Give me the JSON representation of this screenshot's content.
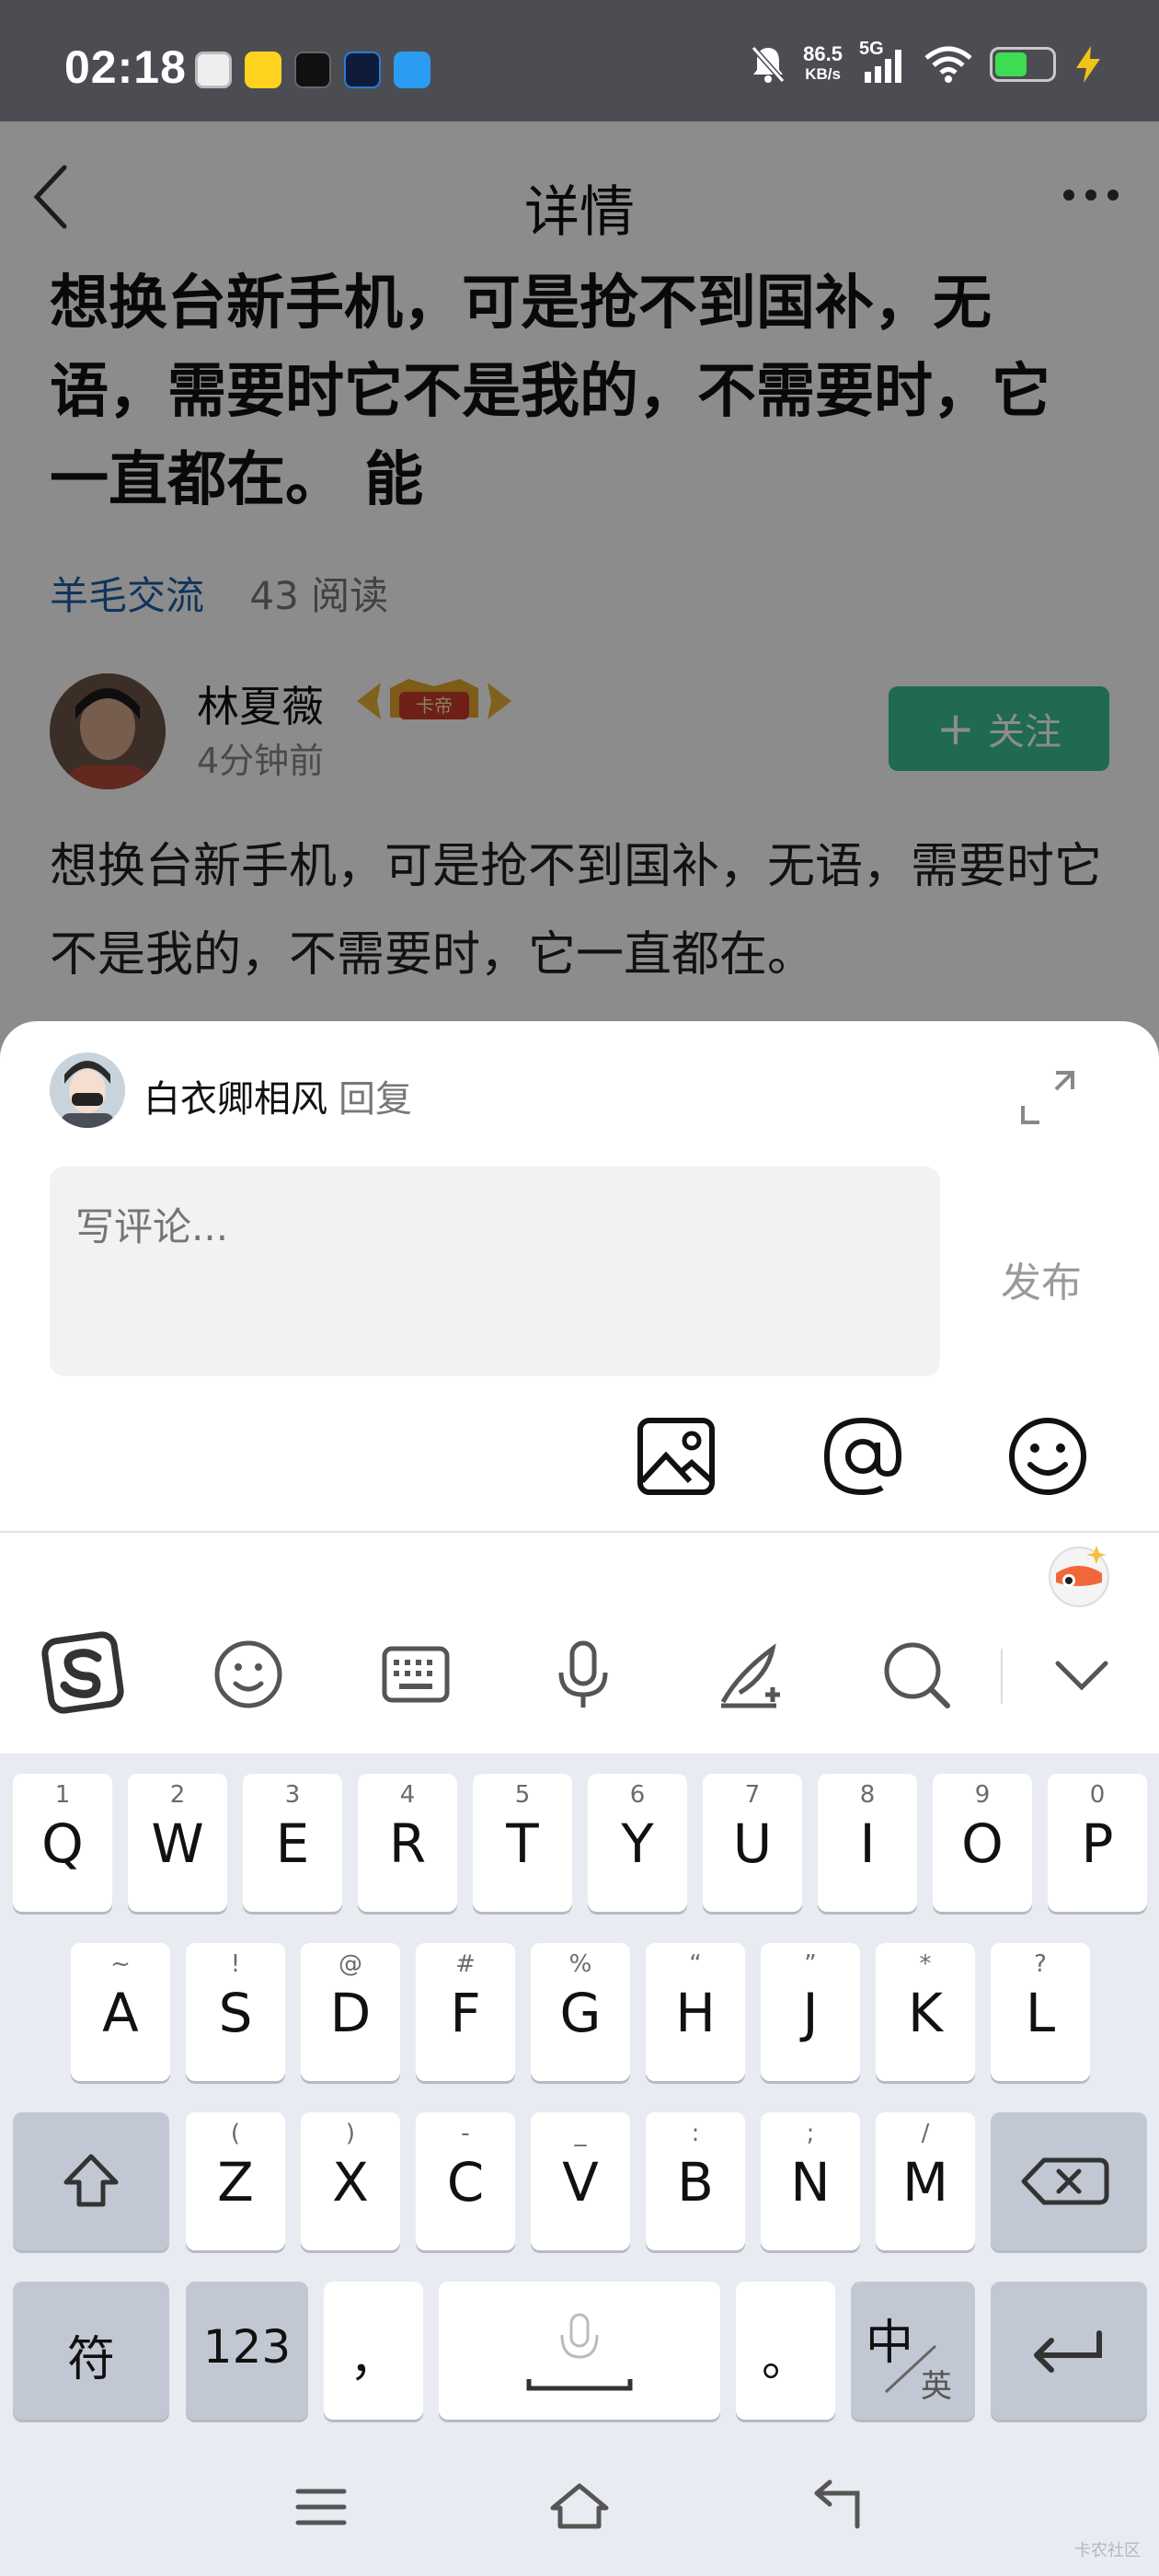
{
  "status_bar": {
    "time": "02:18",
    "net_speed_value": "86.5",
    "net_speed_unit": "KB/s",
    "network": "5G",
    "icons": [
      "mute-icon",
      "signal-icon",
      "wifi-icon",
      "battery-icon",
      "charging-icon"
    ]
  },
  "nav": {
    "title": "详情",
    "back_icon": "chevron-left-icon",
    "more_icon": "more-dots-icon"
  },
  "post": {
    "title": "想换台新手机，可是抢不到国补，无语，需要时它不是我的，不需要时，它一直都在。 能",
    "category": "羊毛交流",
    "read_count": "43 阅读",
    "author": "林夏薇",
    "author_badge": "卡帝",
    "time_ago": "4分钟前",
    "follow_label": "关注",
    "body": "想换台新手机，可是抢不到国补，无语，需要时它不是我的，不需要时，它一直都在。"
  },
  "reply": {
    "target_user": "白衣卿相风",
    "reply_label": "回复",
    "placeholder": "写评论...",
    "publish_label": "发布",
    "tools": [
      "image-icon",
      "mention-icon",
      "emoji-icon"
    ]
  },
  "keyboard": {
    "row1": [
      {
        "main": "Q",
        "sub": "1"
      },
      {
        "main": "W",
        "sub": "2"
      },
      {
        "main": "E",
        "sub": "3"
      },
      {
        "main": "R",
        "sub": "4"
      },
      {
        "main": "T",
        "sub": "5"
      },
      {
        "main": "Y",
        "sub": "6"
      },
      {
        "main": "U",
        "sub": "7"
      },
      {
        "main": "I",
        "sub": "8"
      },
      {
        "main": "O",
        "sub": "9"
      },
      {
        "main": "P",
        "sub": "0"
      }
    ],
    "row2": [
      {
        "main": "A",
        "sub": "~"
      },
      {
        "main": "S",
        "sub": "!"
      },
      {
        "main": "D",
        "sub": "@"
      },
      {
        "main": "F",
        "sub": "#"
      },
      {
        "main": "G",
        "sub": "%"
      },
      {
        "main": "H",
        "sub": "“"
      },
      {
        "main": "J",
        "sub": "”"
      },
      {
        "main": "K",
        "sub": "*"
      },
      {
        "main": "L",
        "sub": "?"
      }
    ],
    "row3": [
      {
        "main": "Z",
        "sub": "("
      },
      {
        "main": "X",
        "sub": ")"
      },
      {
        "main": "C",
        "sub": "-"
      },
      {
        "main": "V",
        "sub": "_"
      },
      {
        "main": "B",
        "sub": ":"
      },
      {
        "main": "N",
        "sub": ";"
      },
      {
        "main": "M",
        "sub": "/"
      }
    ],
    "symbol_key": "符",
    "number_key": "123",
    "comma_key": "，",
    "period_key": "。",
    "lang_key_main": "中",
    "lang_key_sub": "英",
    "watermark": "卡农社区"
  },
  "colors": {
    "status_bg": "#4b4d52",
    "follow_button": "#3ac192",
    "category_link": "#1e5fa8",
    "keyboard_bg": "#e9ebf2"
  }
}
